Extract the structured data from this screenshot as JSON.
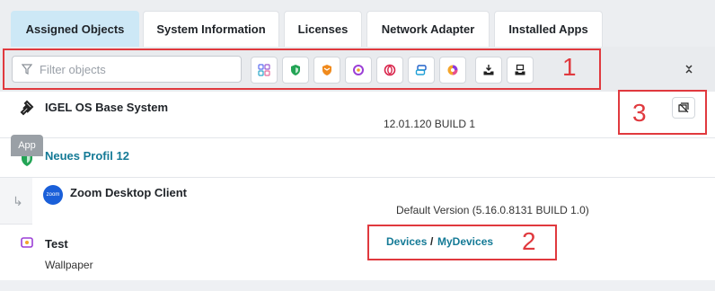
{
  "tabs": [
    {
      "label": "Assigned Objects",
      "active": true
    },
    {
      "label": "System Information"
    },
    {
      "label": "Licenses"
    },
    {
      "label": "Network Adapter"
    },
    {
      "label": "Installed Apps"
    }
  ],
  "toolbar": {
    "filter_placeholder": "Filter objects",
    "filter_icon": "funnel-icon",
    "buttons": [
      "apps-grid-icon",
      "shield-icon",
      "badge-icon",
      "gear-plugin-icon",
      "ring-icon",
      "stack-icon",
      "pie-icon",
      "download-tray-icon",
      "upload-tray-icon"
    ],
    "collapse_icon": "chevrons-collapse-icon"
  },
  "rows": [
    {
      "name": "IGEL OS Base System",
      "value": "12.01.120 BUILD 1"
    },
    {
      "badge": "App",
      "name": "Neues Profil 12"
    },
    {
      "name": "Zoom Desktop Client",
      "value": "Default Version (5.16.0.8131 BUILD 1.0)",
      "icon_text": "zoom"
    },
    {
      "name": "Test",
      "sub": "Wallpaper",
      "path": [
        "Devices",
        "MyDevices"
      ],
      "separator": "/"
    }
  ],
  "annotations": [
    "1",
    "2",
    "3"
  ],
  "colors": {
    "accent_tab": "#cde8f6",
    "link": "#147a96",
    "annotation": "#e0393e"
  }
}
